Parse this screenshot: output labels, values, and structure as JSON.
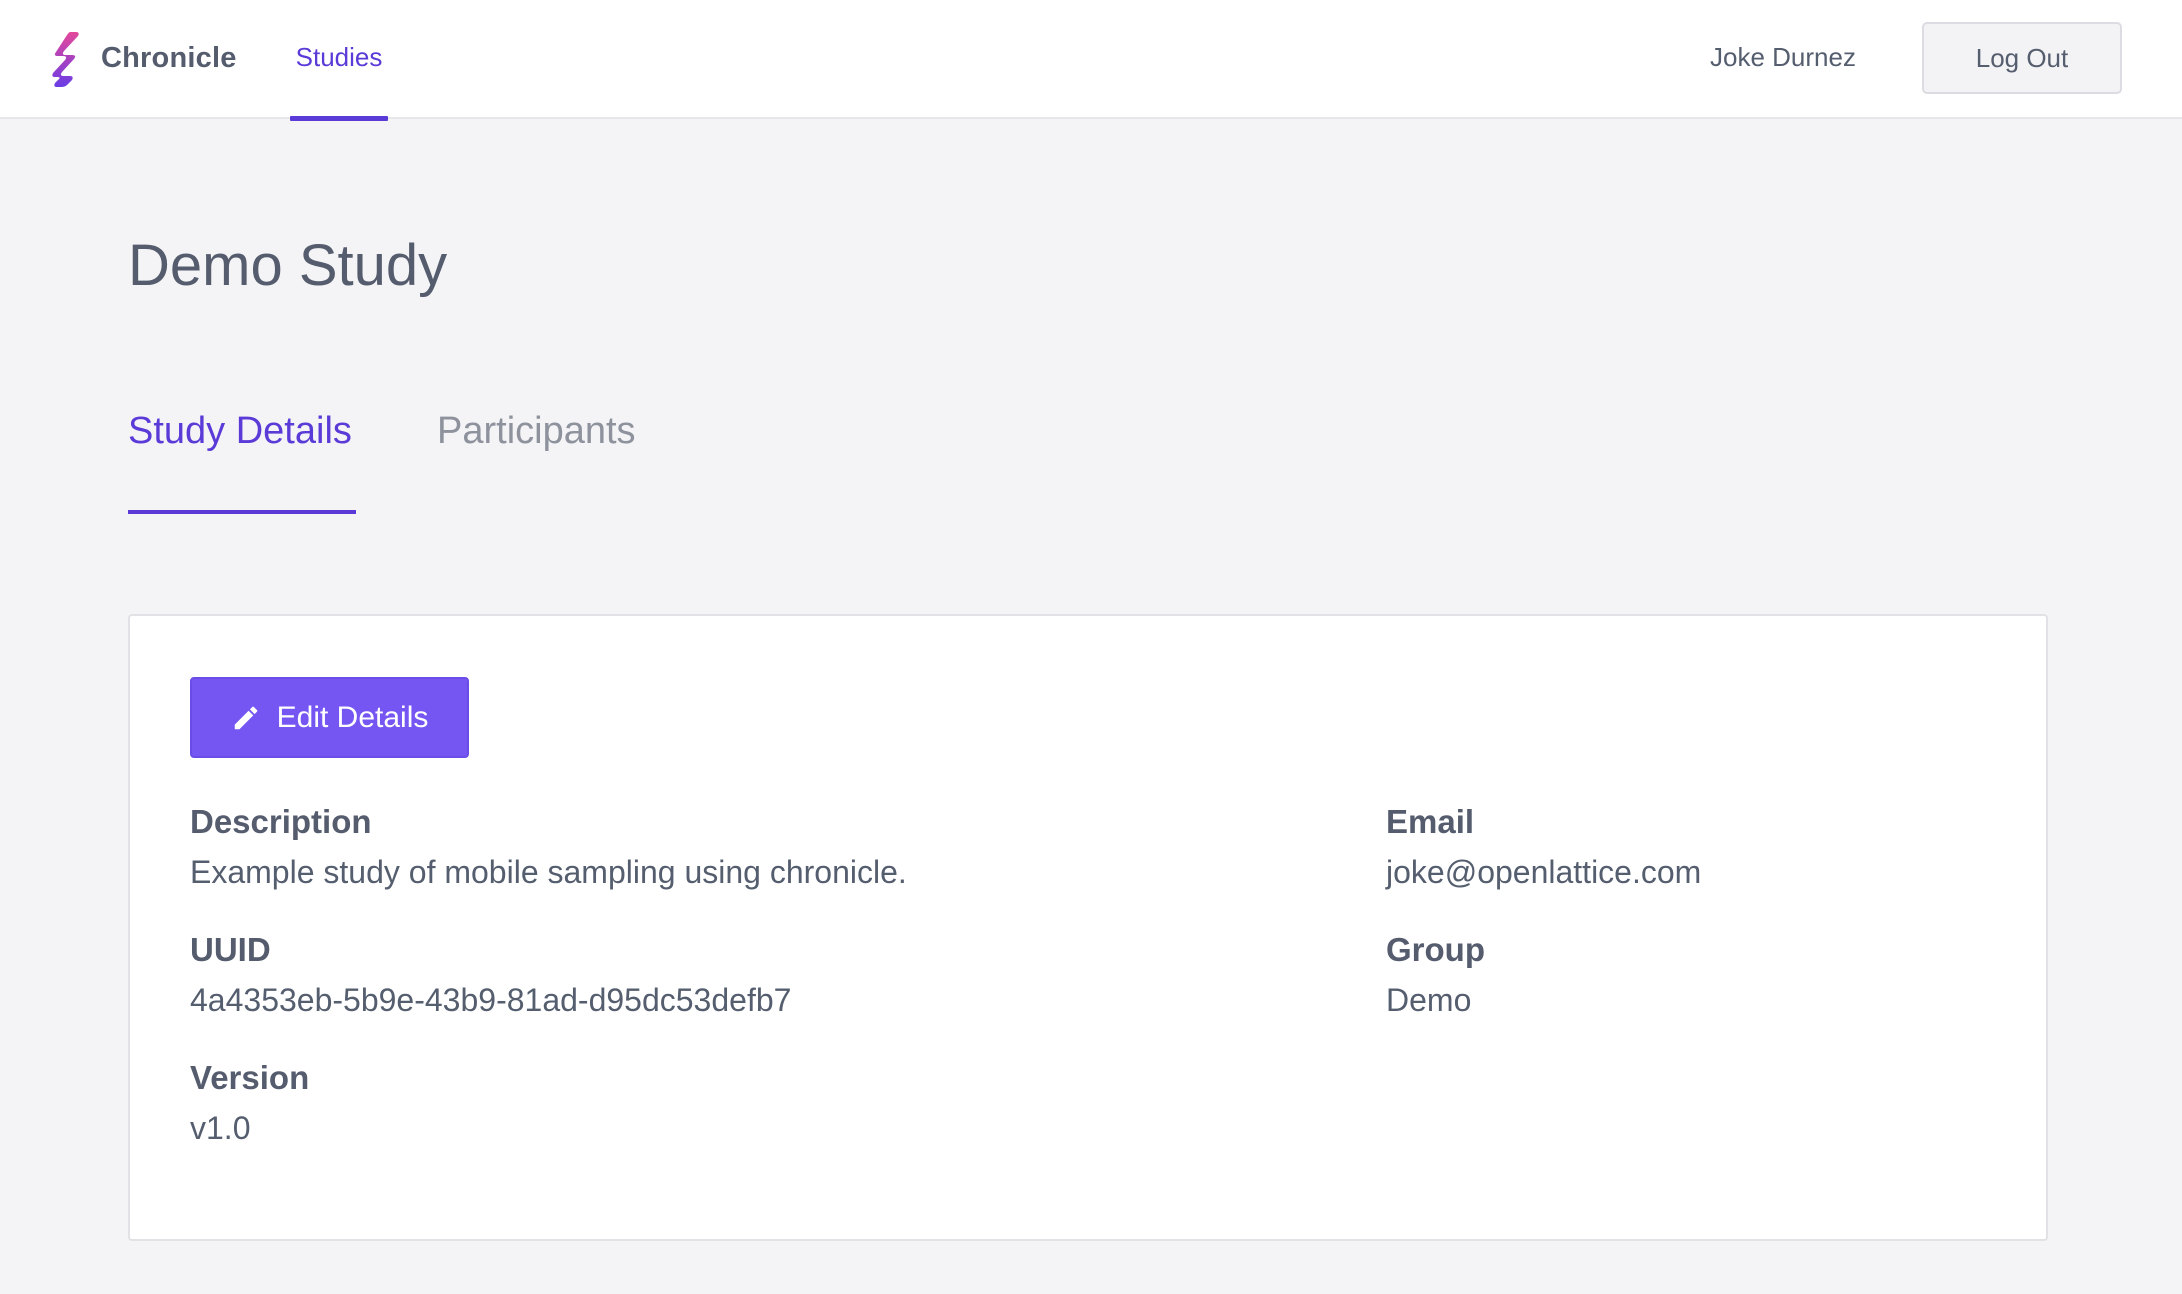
{
  "header": {
    "brand_name": "Chronicle",
    "nav_studies": "Studies",
    "user_name": "Joke Durnez",
    "logout_label": "Log Out"
  },
  "page": {
    "title": "Demo Study"
  },
  "tabs": {
    "details": "Study Details",
    "participants": "Participants",
    "active": "details"
  },
  "details": {
    "edit_label": "Edit Details",
    "description_label": "Description",
    "description_value": "Example study of mobile sampling using chronicle.",
    "uuid_label": "UUID",
    "uuid_value": "4a4353eb-5b9e-43b9-81ad-d95dc53defb7",
    "version_label": "Version",
    "version_value": "v1.0",
    "email_label": "Email",
    "email_value": "joke@openlattice.com",
    "group_label": "Group",
    "group_value": "Demo"
  },
  "colors": {
    "accent": "#5b3bd8",
    "button_primary": "#7556f2",
    "background": "#f4f4f6",
    "text": "#555e6e",
    "logo_pink": "#e4489a",
    "logo_purple": "#6a3ce6"
  },
  "icons": {
    "brand": "chronicle-logo-icon",
    "edit": "pencil-icon"
  }
}
